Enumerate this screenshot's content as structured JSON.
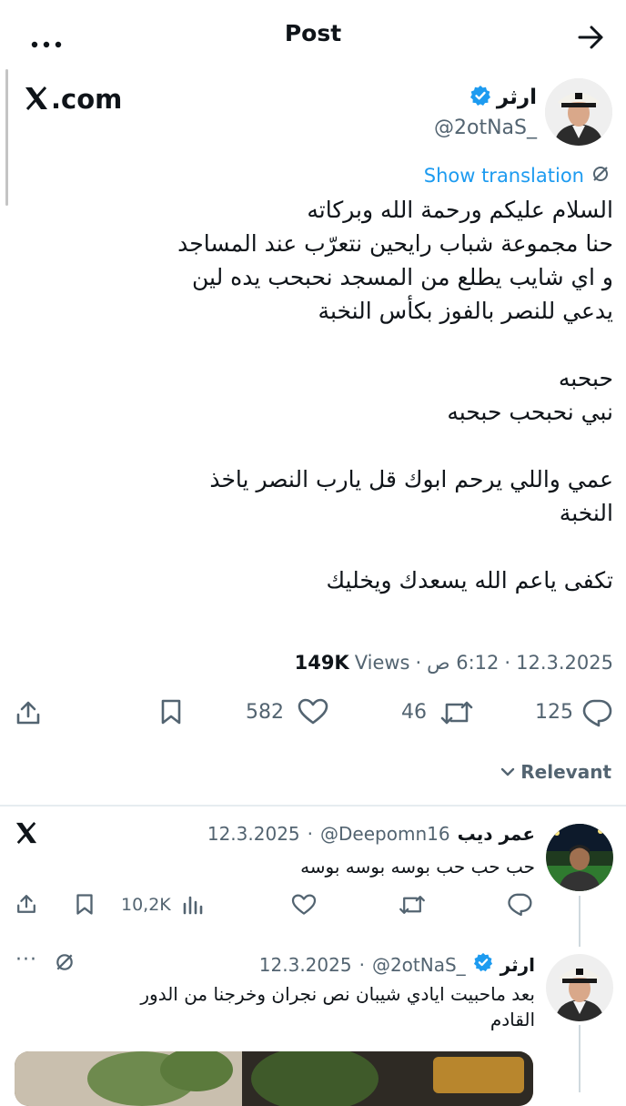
{
  "topbar": {
    "title": "Post"
  },
  "watermark": {
    "text": "X.com"
  },
  "author": {
    "display_name": "ارثر",
    "handle": "@2otNaS_"
  },
  "post": {
    "translate_label": "Show translation",
    "text": "السلام عليكم ورحمة الله وبركاته\nحنا مجموعة شباب رايحين نتعرّب عند المساجد\nو اي شايب يطلع من المسجد نحبحب يده لين\nيدعي للنصر بالفوز بكأس النخبة\n\nحبحبه\nنبي نحبحب حبحبه\n\nعمي واللي يرحم ابوك قل يارب النصر ياخذ\nالنخبة\n\nتكفى ياعم الله يسعدك ويخليك",
    "date": "12.3.2025",
    "time": "6:12 ص",
    "views_count": "149K",
    "views_label": "Views",
    "replies": "125",
    "reposts": "46",
    "likes": "582"
  },
  "sort": {
    "label": "Relevant"
  },
  "replies": [
    {
      "display_name": "عمر ديب",
      "handle": "@Deepomn16",
      "date": "12.3.2025",
      "text": "حب حب حب بوسه بوسه بوسه",
      "views": "10,2K"
    },
    {
      "display_name": "ارثر",
      "handle": "@2otNaS_",
      "date": "12.3.2025",
      "text": "بعد ماحبيت ايادي شيبان نص نجران وخرجنا من الدور\nالقادم",
      "more": "···"
    }
  ],
  "colors": {
    "accent": "#1d9bf0",
    "text": "#0f1419",
    "muted": "#536471",
    "like": "#536471"
  }
}
